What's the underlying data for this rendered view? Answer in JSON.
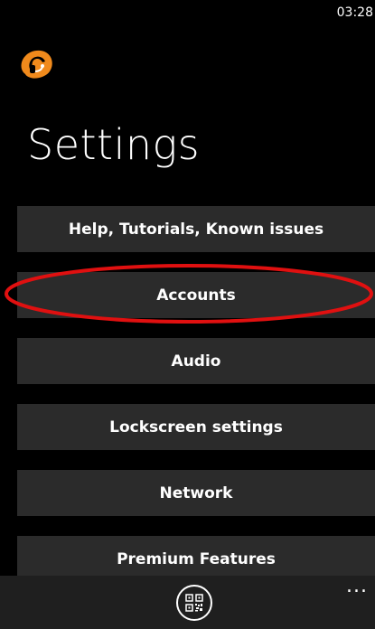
{
  "status_bar": {
    "time": "03:28"
  },
  "app": {
    "logo_icon": "headset-logo-icon"
  },
  "page": {
    "title": "Settings"
  },
  "menu": {
    "items": [
      {
        "label": "Help, Tutorials, Known issues"
      },
      {
        "label": "Accounts"
      },
      {
        "label": "Audio"
      },
      {
        "label": "Lockscreen settings"
      },
      {
        "label": "Network"
      },
      {
        "label": "Premium Features"
      }
    ]
  },
  "app_bar": {
    "qr_icon": "qr-code-icon",
    "more_label": "..."
  },
  "colors": {
    "background": "#000000",
    "button_bg": "#2b2b2b",
    "app_bar_bg": "#1f1f1f",
    "logo_orange": "#f08a1c",
    "highlight_red": "#e01010"
  }
}
